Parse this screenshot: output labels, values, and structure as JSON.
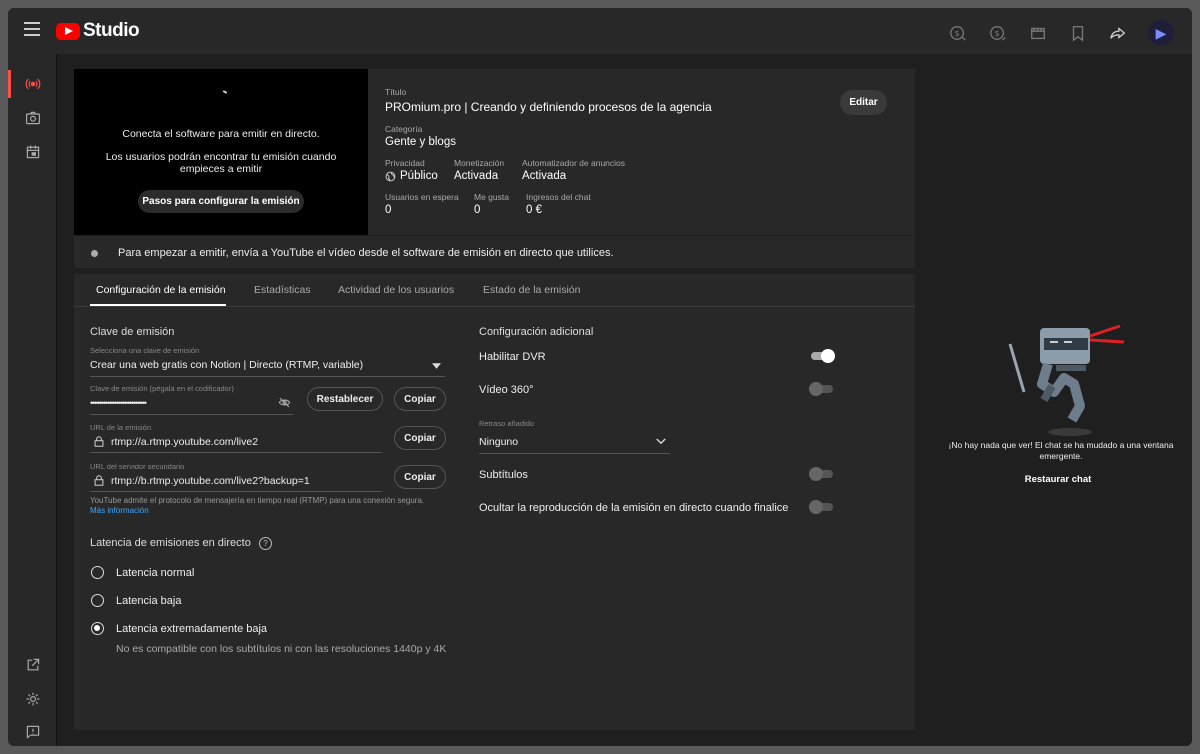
{
  "app": {
    "logo_text": "Studio"
  },
  "header": {
    "icons": [
      "money-in-icon",
      "money-out-icon",
      "clapperboard-icon",
      "bookmark-icon",
      "share-icon"
    ],
    "avatar_letter": "▶"
  },
  "preview": {
    "line1": "Conecta el software para emitir en directo.",
    "line2": "Los usuarios podrán encontrar tu emisión cuando empieces a emitir",
    "setup_button": "Pasos para configurar la emisión"
  },
  "meta": {
    "title_label": "Título",
    "title": "PROmium.pro | Creando y definiendo procesos de la agencia",
    "edit_button": "Editar",
    "category_label": "Categoría",
    "category": "Gente y blogs",
    "privacy_label": "Privacidad",
    "privacy": "Público",
    "monetization_label": "Monetización",
    "monetization": "Activada",
    "ads_label": "Automatizador de anuncios",
    "ads": "Activada",
    "waiting_label": "Usuarios en espera",
    "waiting": "0",
    "likes_label": "Me gusta",
    "likes": "0",
    "chat_income_label": "Ingresos del chat",
    "chat_income": "0 €"
  },
  "status": {
    "text": "Para empezar a emitir, envía a YouTube el vídeo desde el software de emisión en directo que utilices."
  },
  "tabs": [
    {
      "label": "Configuración de la emisión"
    },
    {
      "label": "Estadísticas"
    },
    {
      "label": "Actividad de los usuarios"
    },
    {
      "label": "Estado de la emisión"
    }
  ],
  "stream_key": {
    "heading": "Clave de emisión",
    "select_label": "Selecciona una clave de emisión",
    "select_value": "Crear una web gratis con Notion | Directo (RTMP, variable)",
    "key_label": "Clave de emisión (pégala en el codificador)",
    "key_value": "••••••••••••••••••••••••••",
    "reset_button": "Restablecer",
    "copy_button": "Copiar",
    "url_label": "URL de la emisión",
    "url_value": "rtmp://a.rtmp.youtube.com/live2",
    "backup_label": "URL del servidor secundario",
    "backup_value": "rtmp://b.rtmp.youtube.com/live2?backup=1",
    "rtmp_note": "YouTube admite el protocolo de mensajería en tiempo real (RTMP) para una conexión segura.",
    "more_info": "Más información"
  },
  "latency": {
    "heading": "Latencia de emisiones en directo",
    "help": "?",
    "options": [
      {
        "label": "Latencia normal",
        "selected": false
      },
      {
        "label": "Latencia baja",
        "selected": false
      },
      {
        "label": "Latencia extremadamente baja",
        "selected": true
      }
    ],
    "note": "No es compatible con los subtítulos ni con las resoluciones 1440p y 4K"
  },
  "additional": {
    "heading": "Configuración adicional",
    "dvr_label": "Habilitar DVR",
    "dvr_on": true,
    "vr_label": "Vídeo 360°",
    "vr_on": false,
    "delay_label": "Retraso añadido",
    "delay_value": "Ninguno",
    "subtitles_label": "Subtítulos",
    "subtitles_on": false,
    "hide_label": "Ocultar la reproducción de la emisión en directo cuando finalice",
    "hide_on": false
  },
  "chat": {
    "message": "¡No hay nada que ver! El chat se ha mudado a una ventana emergente.",
    "restore_button": "Restaurar chat"
  },
  "colors": {
    "accent_red": "#ff0000",
    "live_red": "#ff4e45",
    "link_blue": "#3ea6ff"
  }
}
